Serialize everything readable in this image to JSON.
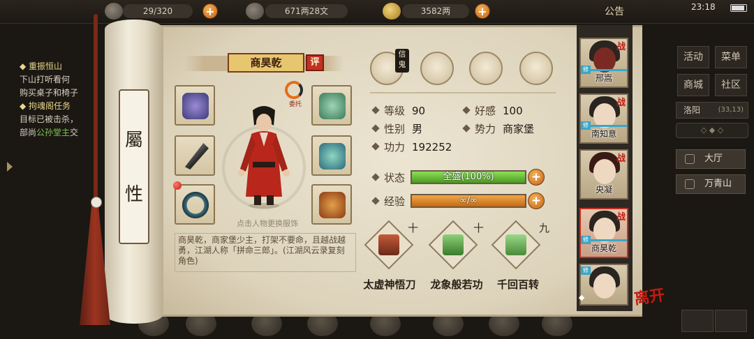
{
  "topbar": {
    "resource1": "29/320",
    "resource2": "671两28文",
    "resource3": "3582两",
    "notice": "公告",
    "clock": "23:18"
  },
  "quest": {
    "line1_head": "重振恒山",
    "line1_text": "下山打听看何",
    "line1_text2": "购买桌子和椅子",
    "line2_head": "拘魂阁任务",
    "line2_text": "目标已被击杀，",
    "line2_text2a": "部尚",
    "line2_highlight": "公孙堂主",
    "line2_text2b": "交"
  },
  "right_menu": {
    "btn_activity": "活动",
    "btn_menu": "菜单",
    "btn_shop": "商城",
    "btn_community": "社区",
    "location": "洛阳",
    "coords": "(33,13)",
    "dest1": "大厅",
    "dest2": "万青山"
  },
  "scroll": {
    "side_title_1": "屬",
    "side_title_2": "性"
  },
  "character": {
    "name": "商昊乾",
    "eval_label": "评",
    "delegate_label": "委托",
    "hint": "点击人物更换服饰",
    "description": "商昊乾，商家堡少主，打架不要命，且越战越勇，江湖人称「拼命三郎」。(江湖风云录复刻角色)"
  },
  "top_icons": {
    "xinjian": "信鬼"
  },
  "attributes": {
    "level_label": "等级",
    "level_value": "90",
    "favor_label": "好感",
    "favor_value": "100",
    "gender_label": "性别",
    "gender_value": "男",
    "faction_label": "势力",
    "faction_value": "商家堡",
    "power_label": "功力",
    "power_value": "192252",
    "status_label": "状态",
    "status_value": "全盛(100%)",
    "status_fill": 1.0,
    "exp_label": "经验",
    "exp_value": "∞/∞",
    "exp_fill": 1.0,
    "plus": "+"
  },
  "skills": [
    {
      "level": "十",
      "name": "太虚神悟刀"
    },
    {
      "level": "十",
      "name": "龙象般若功"
    },
    {
      "level": "九",
      "name": "千回百转"
    }
  ],
  "roster": [
    {
      "name": "邢嵩",
      "tag": "战",
      "xiu": "修"
    },
    {
      "name": "南知意",
      "tag": "战",
      "xiu": "修"
    },
    {
      "name": "央凝",
      "tag": "战",
      "xiu": ""
    },
    {
      "name": "商昊乾",
      "tag": "战",
      "xiu": "修"
    },
    {
      "name": "",
      "tag": "",
      "xiu": "修"
    }
  ],
  "leave_label": "离开",
  "colors": {
    "status_bar": "#6fc23a",
    "exp_bar": "#e08a1e",
    "accent_red": "#c23223",
    "parchment": "#e6dfcb"
  }
}
